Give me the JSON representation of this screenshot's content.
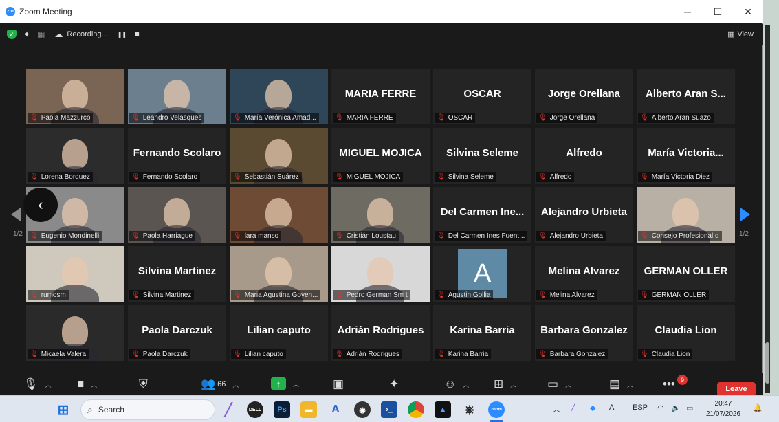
{
  "window": {
    "title": "Zoom Meeting",
    "minimize": "─",
    "maximize": "☐",
    "close": "✕"
  },
  "topbar": {
    "recording_label": "Recording...",
    "pause_icon": "❚❚",
    "stop_icon": "■",
    "view_label": "View"
  },
  "page_indicator": {
    "left": "1/2",
    "right": "1/2"
  },
  "participants": [
    {
      "name": "Paola Mazzurco",
      "video": true,
      "bg": "#7a6555"
    },
    {
      "name": "Leandro Velasques",
      "video": true,
      "bg": "#6b7f8e",
      "active": true
    },
    {
      "name": "María Verónica Amad...",
      "video": true,
      "bg": "#2f4558"
    },
    {
      "name": "MARIA FERRE",
      "display": "MARIA FERRE",
      "video": false
    },
    {
      "name": "OSCAR",
      "display": "OSCAR",
      "video": false
    },
    {
      "name": "Jorge Orellana",
      "display": "Jorge Orellana",
      "video": false
    },
    {
      "name": "Alberto Aran Suazo",
      "display": "Alberto Aran S...",
      "video": false
    },
    {
      "name": "Lorena Borquez",
      "video": true,
      "bg": "#2c2c2c"
    },
    {
      "name": "Fernando Scolaro",
      "display": "Fernando Scolaro",
      "video": false
    },
    {
      "name": "Sebastián Suárez",
      "video": true,
      "bg": "#5a4a32"
    },
    {
      "name": "MIGUEL MOJICA",
      "display": "MIGUEL MOJICA",
      "video": false
    },
    {
      "name": "Silvina Seleme",
      "display": "Silvina Seleme",
      "video": false
    },
    {
      "name": "Alfredo",
      "display": "Alfredo",
      "video": false
    },
    {
      "name": "María Victoria Diez",
      "display": "María Victoria...",
      "video": false
    },
    {
      "name": "Eugenio Mondinelli",
      "video": true,
      "bg": "#8a8a8a"
    },
    {
      "name": "Paola Harriague",
      "video": true,
      "bg": "#5a5550"
    },
    {
      "name": "lara manso",
      "video": true,
      "bg": "#6e4b35"
    },
    {
      "name": "Cristián Loustau",
      "video": true,
      "bg": "#6d6b62"
    },
    {
      "name": "Del Carmen Ines Fuent...",
      "display": "Del Carmen Ine...",
      "video": false
    },
    {
      "name": "Alejandro Urbieta",
      "display": "Alejandro Urbieta",
      "video": false
    },
    {
      "name": "Consejo Profesional d",
      "video": true,
      "bg": "#b8b0a4"
    },
    {
      "name": "rumosm",
      "video": true,
      "bg": "#cfc8bc"
    },
    {
      "name": "Silvina Martinez",
      "display": "Silvina Martinez",
      "video": false
    },
    {
      "name": "Maria Agustina Goyen...",
      "video": true,
      "bg": "#a89a8a"
    },
    {
      "name": "Pedro German Sm t",
      "video": true,
      "bg": "#d8d8d8"
    },
    {
      "name": "Agustin Gollia",
      "avatar": "A",
      "video": false
    },
    {
      "name": "Melina Alvarez",
      "display": "Melina Alvarez",
      "video": false
    },
    {
      "name": "GERMAN OLLER",
      "display": "GERMAN OLLER",
      "video": false
    },
    {
      "name": "Micaela Valera",
      "video": true,
      "bg": "#2a2a2a"
    },
    {
      "name": "Paola Darczuk",
      "display": "Paola Darczuk",
      "video": false
    },
    {
      "name": "Lilian caputo",
      "display": "Lilian caputo",
      "video": false
    },
    {
      "name": "Adrián Rodrigues",
      "display": "Adrián Rodrigues",
      "video": false
    },
    {
      "name": "Karina Barria",
      "display": "Karina Barria",
      "video": false
    },
    {
      "name": "Barbara Gonzalez",
      "display": "Barbara Gonzalez",
      "video": false
    },
    {
      "name": "Claudia Lion",
      "display": "Claudia Lion",
      "video": false
    }
  ],
  "toolbar": {
    "participants_count": "66",
    "more_badge": "9",
    "leave_label": "Leave"
  },
  "taskbar": {
    "search_placeholder": "Search",
    "language": "ESP",
    "time": "20:47",
    "date": "21/07/2026"
  },
  "colors": {
    "accent": "#2d8cff",
    "muted_red": "#e0332f",
    "active_speaker": "#c8d64e",
    "leave": "#e0332f"
  }
}
